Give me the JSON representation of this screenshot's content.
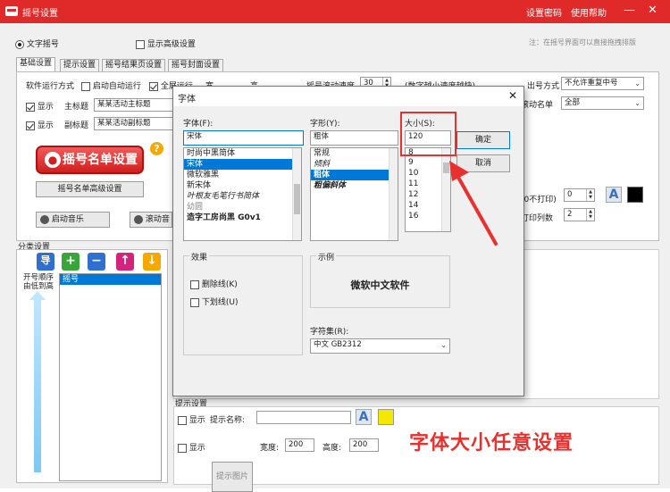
{
  "window": {
    "title": "摇号设置",
    "link_password": "设置密码",
    "link_help": "使用帮助",
    "min_glyph": "—",
    "close_glyph": "✕"
  },
  "mode": {
    "radio_text": "文字摇号",
    "chk_advanced": "显示高级设置",
    "hint": "注：在摇号界面可以直接拖拽排版"
  },
  "tabs": [
    "基础设置",
    "提示设置",
    "摇号结果页设置",
    "摇号封面设置"
  ],
  "basic": {
    "run_mode_label": "软件运行方式",
    "auto_run": "启动自动运行",
    "fullscreen": "全屏运行",
    "width_label": "宽",
    "height_label": "高",
    "speed_label": "摇号滚动速度",
    "speed_value": "30",
    "speed_hint": "(数字越小速度越快)",
    "output_label": "出号方式",
    "output_value": "不允许重复中号",
    "show_label": "显示",
    "main_title_label": "主标题",
    "main_title_value": "某某活动主标题",
    "sub_title_label": "副标题",
    "sub_title_value": "某某活动副标题",
    "scroll_list_label": "滚动名单",
    "scroll_list_value": "全部",
    "list_button": "摇号名单设置",
    "list_adv_button": "摇号名单高级设置",
    "music_start": "启动音乐",
    "music_scroll": "滚动音",
    "print_label": "(0不打印)",
    "print_value": "0",
    "print_cols_label": "打印列数",
    "print_cols_value": "2",
    "font_glyph": "A"
  },
  "category": {
    "title": "分类设置",
    "import_label": "导",
    "order_label": "开号顺序由低到高",
    "items": [
      "摇号"
    ]
  },
  "tips": {
    "title": "提示设置",
    "show_label": "显示",
    "name_label": "提示名称:",
    "name_value": "",
    "font_glyph": "A",
    "show2_label": "显示",
    "image_button": "提示图片",
    "width_label": "宽度:",
    "width_value": "200",
    "height_label": "高度:",
    "height_value": "200"
  },
  "dialog": {
    "title": "字体",
    "close_glyph": "✕",
    "font_label": "字体(F):",
    "font_value": "宋体",
    "fonts": [
      "时尚中黑简体",
      "宋体",
      "微软雅黑",
      "新宋体",
      "叶根友毛笔行书简体",
      "幼圆",
      "造字工房尚黑 G0v1"
    ],
    "style_label": "字形(Y):",
    "style_value": "粗体",
    "styles": [
      "常规",
      "倾斜",
      "粗体",
      "粗偏斜体"
    ],
    "size_label": "大小(S):",
    "size_value": "120",
    "sizes": [
      "8",
      "9",
      "10",
      "11",
      "12",
      "14",
      "16"
    ],
    "ok": "确定",
    "cancel": "取消",
    "effects_title": "效果",
    "strike": "删除线(K)",
    "underline": "下划线(U)",
    "sample_title": "示例",
    "sample_text": "微软中文软件",
    "charset_label": "字符集(R):",
    "charset_value": "中文 GB2312"
  },
  "annotation": {
    "text": "字体大小任意设置",
    "color": "#e8312f"
  },
  "colors": {
    "title_red": "#e02a2a",
    "highlight": "#0078d7",
    "yellow": "#f5e800"
  }
}
